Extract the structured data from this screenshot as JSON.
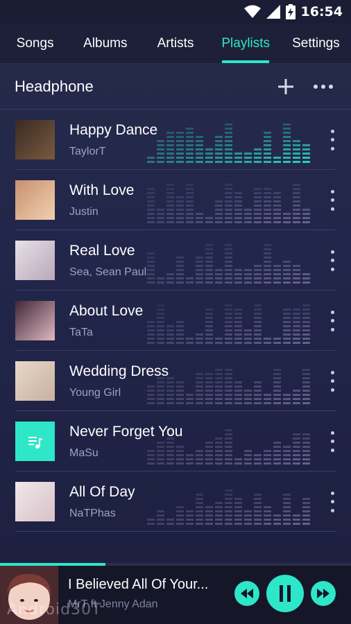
{
  "status_bar": {
    "time": "16:54"
  },
  "tabs": [
    {
      "label": "Songs",
      "active": false
    },
    {
      "label": "Albums",
      "active": false
    },
    {
      "label": "Artists",
      "active": false
    },
    {
      "label": "Playlists",
      "active": true
    },
    {
      "label": "Settings",
      "active": false
    }
  ],
  "playlist": {
    "title": "Headphone",
    "add_icon": "plus-icon",
    "menu_icon": "more-horizontal-icon"
  },
  "songs": [
    {
      "title": "Happy Dance",
      "artist": "TaylorT",
      "playing": true,
      "thumb_colors": [
        "#3a2a22",
        "#7a5a40"
      ]
    },
    {
      "title": "With Love",
      "artist": "Justin",
      "playing": false,
      "thumb_colors": [
        "#c89070",
        "#f0d0b0"
      ]
    },
    {
      "title": "Real Love",
      "artist": "Sea, Sean Paul",
      "playing": false,
      "thumb_colors": [
        "#e8e0e8",
        "#b8a8b8"
      ]
    },
    {
      "title": "About Love",
      "artist": "TaTa",
      "playing": false,
      "thumb_colors": [
        "#402838",
        "#e0b8c0"
      ]
    },
    {
      "title": "Wedding Dress",
      "artist": "Young Girl",
      "playing": false,
      "thumb_colors": [
        "#e8d8c8",
        "#c8b0a0"
      ]
    },
    {
      "title": "Never Forget You",
      "artist": "MaSu",
      "playing": false,
      "thumb_colors": [
        "#2ee6c8",
        "#2ee6c8"
      ],
      "placeholder_icon": "music-note-icon"
    },
    {
      "title": "All Of Day",
      "artist": "NaTPhas",
      "playing": false,
      "thumb_colors": [
        "#f0e8ec",
        "#d8c0c8"
      ]
    }
  ],
  "now_playing": {
    "title": "I Believed All Of Your...",
    "artist": "MrT ft Jenny Adan",
    "progress": 0.3
  },
  "watermark": "Android30T",
  "colors": {
    "accent": "#2ee6c8",
    "background": "#22264a",
    "bar": "#1d2038"
  }
}
